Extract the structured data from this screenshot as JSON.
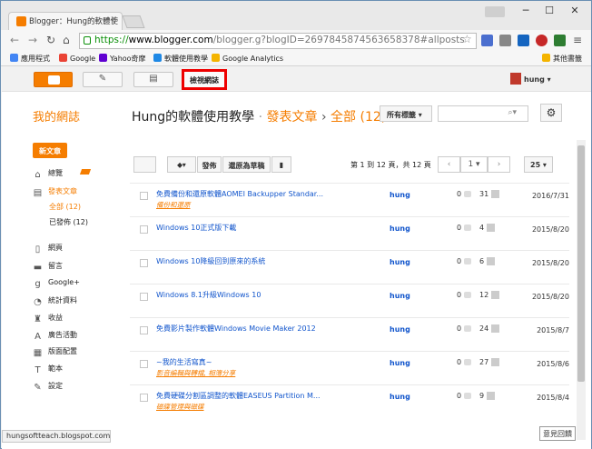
{
  "browser": {
    "tab_title": "Blogger：Hung的軟體使",
    "url_https": "https://",
    "url_domain": "www.blogger.com",
    "url_path": "/blogger.g?blogID=2697845874563658378#allposts",
    "window_controls": [
      "─",
      "☐",
      "✕"
    ],
    "bookmarks": [
      {
        "label": "應用程式",
        "color": "#4285f4"
      },
      {
        "label": "Google",
        "color": "#ea4335"
      },
      {
        "label": "Yahoo奇摩",
        "color": "#5f01d1"
      },
      {
        "label": "軟體使用教學",
        "color": "#1e88e5"
      },
      {
        "label": "Google Analytics",
        "color": "#f4b400"
      }
    ],
    "other_bookmarks": "其他書籤",
    "status_url": "hungsoftteach.blogspot.com"
  },
  "blogger": {
    "view_blog": "檢視網誌",
    "user": "hung",
    "my_blogs": "我的網誌",
    "blog_name": "Hung的軟體使用教學",
    "sep": "·",
    "breadcrumb_posts": "發表文章",
    "breadcrumb_arrow": "›",
    "breadcrumb_all": "全部 (12)",
    "label_select": "所有標籤",
    "new_post": "新文章",
    "feedback": "意見回饋"
  },
  "sidebar": [
    {
      "label": "總覽",
      "icon": "⌂",
      "name": "home-icon"
    },
    {
      "label": "發表文章",
      "icon": "▤",
      "name": "posts-icon",
      "active": true
    },
    {
      "label": "全部 (12)",
      "sub": true,
      "active": true
    },
    {
      "label": "已發佈 (12)",
      "sub": true
    },
    {
      "label": "網頁",
      "icon": "▯",
      "name": "pages-icon"
    },
    {
      "label": "留言",
      "icon": "▬",
      "name": "comments-icon"
    },
    {
      "label": "Google+",
      "icon": "g",
      "name": "google-plus-icon"
    },
    {
      "label": "統計資料",
      "icon": "◔",
      "name": "stats-icon"
    },
    {
      "label": "收益",
      "icon": "♜",
      "name": "earnings-icon"
    },
    {
      "label": "廣告活動",
      "icon": "A",
      "name": "campaigns-icon"
    },
    {
      "label": "版面配置",
      "icon": "▦",
      "name": "layout-icon"
    },
    {
      "label": "範本",
      "icon": "T",
      "name": "template-icon"
    },
    {
      "label": "設定",
      "icon": "✎",
      "name": "settings-icon"
    }
  ],
  "actions": {
    "publish": "發佈",
    "revert": "還原為草稿",
    "page_info": "第 1 到 12 頁，共 12 頁",
    "page_num": "1",
    "page_size": "25"
  },
  "posts": [
    {
      "title": "免費備份和還原軟體AOMEI Backupper Standar...",
      "label": "備份和還原",
      "author": "hung",
      "comments": "0",
      "views": "31",
      "date": "2016/7/31"
    },
    {
      "title": "Windows 10正式版下載",
      "label": "",
      "author": "hung",
      "comments": "0",
      "views": "4",
      "date": "2015/8/20"
    },
    {
      "title": "Windows 10降級回到原來的系統",
      "label": "",
      "author": "hung",
      "comments": "0",
      "views": "6",
      "date": "2015/8/20"
    },
    {
      "title": "Windows 8.1升級Windows 10",
      "label": "",
      "author": "hung",
      "comments": "0",
      "views": "12",
      "date": "2015/8/20"
    },
    {
      "title": "免費影片製作軟體Windows Movie Maker 2012",
      "label": "",
      "author": "hung",
      "comments": "0",
      "views": "24",
      "date": "2015/8/7"
    },
    {
      "title": "~我的生活寫真~",
      "label": "影音編輯與轉檔, 相簿分享",
      "author": "hung",
      "comments": "0",
      "views": "27",
      "date": "2015/8/6"
    },
    {
      "title": "免費硬碟分割區調整的軟體EASEUS Partition M...",
      "label": "磁碟管理與磁碟",
      "author": "hung",
      "comments": "0",
      "views": "9",
      "date": "2015/8/4"
    }
  ]
}
